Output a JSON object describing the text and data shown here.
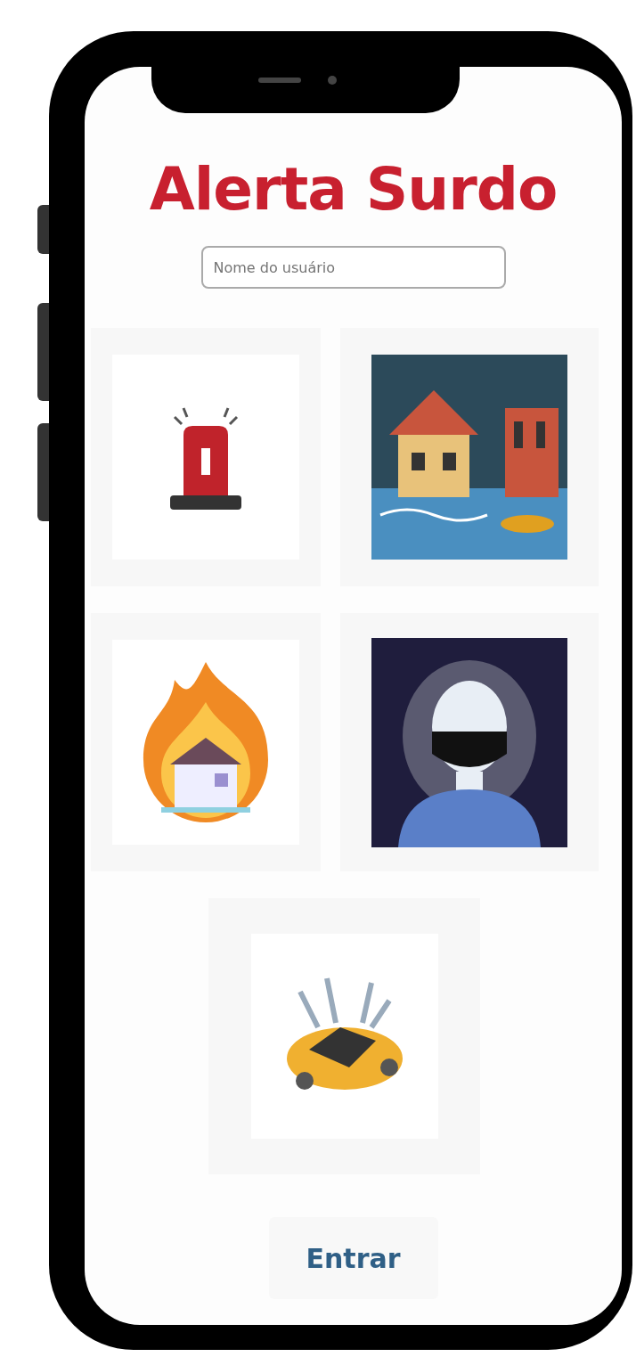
{
  "app": {
    "title": "Alerta Surdo"
  },
  "username": {
    "placeholder": "Nome do usuário"
  },
  "alerts": [
    {
      "kind": "siren"
    },
    {
      "kind": "flood"
    },
    {
      "kind": "fire"
    },
    {
      "kind": "person"
    },
    {
      "kind": "crash"
    }
  ],
  "button": {
    "label": "Entrar"
  }
}
